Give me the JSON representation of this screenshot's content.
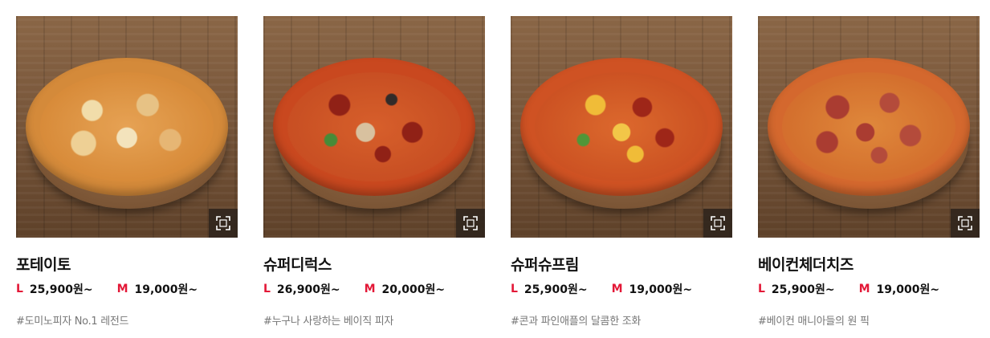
{
  "products": [
    {
      "name": "포테이토",
      "large_label": "L",
      "large_price": "25,900원~",
      "medium_label": "M",
      "medium_price": "19,000원~",
      "tagline": "#도미노피자 No.1 레전드",
      "image_alt": "포테이토 피자"
    },
    {
      "name": "슈퍼디럭스",
      "large_label": "L",
      "large_price": "26,900원~",
      "medium_label": "M",
      "medium_price": "20,000원~",
      "tagline": "#누구나 사랑하는 베이직 피자",
      "image_alt": "슈퍼디럭스 피자"
    },
    {
      "name": "슈퍼슈프림",
      "large_label": "L",
      "large_price": "25,900원~",
      "medium_label": "M",
      "medium_price": "19,000원~",
      "tagline": "#콘과 파인애플의 달콤한 조화",
      "image_alt": "슈퍼슈프림 피자"
    },
    {
      "name": "베이컨체더치즈",
      "large_label": "L",
      "large_price": "25,900원~",
      "medium_label": "M",
      "medium_price": "19,000원~",
      "tagline": "#베이컨 매니아들의 원 픽",
      "image_alt": "베이컨체더치즈 피자"
    }
  ],
  "zoom_icon": "zoom-expand-icon",
  "colors": {
    "size_accent": "#e31837",
    "tagline": "#777777",
    "zoom_bg": "#2d231c"
  }
}
